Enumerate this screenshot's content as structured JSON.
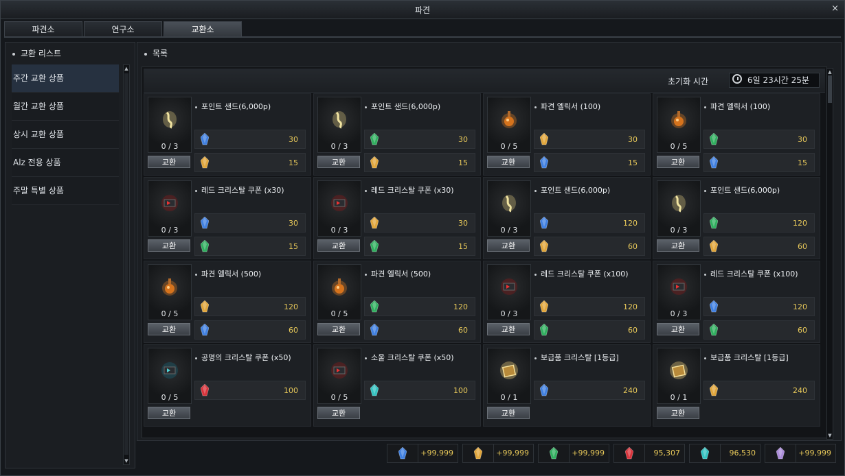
{
  "window": {
    "title": "파견",
    "close": "×"
  },
  "tabs": [
    {
      "label": "파견소"
    },
    {
      "label": "연구소"
    },
    {
      "label": "교환소",
      "active": true
    }
  ],
  "sidebar": {
    "heading": "교환 리스트",
    "items": [
      {
        "label": "주간 교환 상품",
        "active": true
      },
      {
        "label": "월간 교환 상품"
      },
      {
        "label": "상시 교환 상품"
      },
      {
        "label": "Alz 전용 상품"
      },
      {
        "label": "주말 특별 상품"
      }
    ]
  },
  "main": {
    "heading": "목록",
    "reset_label": "초기화 시간",
    "reset_value": "6일 23시간 25분",
    "exchange_label": "교환"
  },
  "items": [
    {
      "name": "포인트 샌드(6,000p)",
      "art": "sand",
      "count": "0 / 3",
      "costs": [
        {
          "gem": "blue",
          "value": "30"
        },
        {
          "gem": "gold",
          "value": "15"
        }
      ]
    },
    {
      "name": "포인트 샌드(6,000p)",
      "art": "sand",
      "count": "0 / 3",
      "costs": [
        {
          "gem": "green",
          "value": "30"
        },
        {
          "gem": "gold",
          "value": "15"
        }
      ]
    },
    {
      "name": "파견 엘릭서 (100)",
      "art": "elixir",
      "count": "0 / 5",
      "costs": [
        {
          "gem": "gold",
          "value": "30"
        },
        {
          "gem": "blue",
          "value": "15"
        }
      ]
    },
    {
      "name": "파견 엘릭서 (100)",
      "art": "elixir",
      "count": "0 / 5",
      "costs": [
        {
          "gem": "green",
          "value": "30"
        },
        {
          "gem": "blue",
          "value": "15"
        }
      ]
    },
    {
      "name": "레드 크리스탈 쿠폰 (x30)",
      "art": "coupon-red",
      "count": "0 / 3",
      "costs": [
        {
          "gem": "blue",
          "value": "30"
        },
        {
          "gem": "green",
          "value": "15"
        }
      ]
    },
    {
      "name": "레드 크리스탈 쿠폰 (x30)",
      "art": "coupon-red",
      "count": "0 / 3",
      "costs": [
        {
          "gem": "gold",
          "value": "30"
        },
        {
          "gem": "green",
          "value": "15"
        }
      ]
    },
    {
      "name": "포인트 샌드(6,000p)",
      "art": "sand",
      "count": "0 / 3",
      "costs": [
        {
          "gem": "blue",
          "value": "120"
        },
        {
          "gem": "gold",
          "value": "60"
        }
      ]
    },
    {
      "name": "포인트 샌드(6,000p)",
      "art": "sand",
      "count": "0 / 3",
      "costs": [
        {
          "gem": "green",
          "value": "120"
        },
        {
          "gem": "gold",
          "value": "60"
        }
      ]
    },
    {
      "name": "파견 엘릭서 (500)",
      "art": "elixir",
      "count": "0 / 5",
      "costs": [
        {
          "gem": "gold",
          "value": "120"
        },
        {
          "gem": "blue",
          "value": "60"
        }
      ]
    },
    {
      "name": "파견 엘릭서 (500)",
      "art": "elixir",
      "count": "0 / 5",
      "costs": [
        {
          "gem": "green",
          "value": "120"
        },
        {
          "gem": "blue",
          "value": "60"
        }
      ]
    },
    {
      "name": "레드 크리스탈 쿠폰 (x100)",
      "art": "coupon-red",
      "count": "0 / 3",
      "costs": [
        {
          "gem": "gold",
          "value": "120"
        },
        {
          "gem": "green",
          "value": "60"
        }
      ]
    },
    {
      "name": "레드 크리스탈 쿠폰 (x100)",
      "art": "coupon-red",
      "count": "0 / 3",
      "costs": [
        {
          "gem": "blue",
          "value": "120"
        },
        {
          "gem": "green",
          "value": "60"
        }
      ]
    },
    {
      "name": "공명의 크리스탈 쿠폰 (x50)",
      "art": "coupon-teal",
      "count": "0 / 5",
      "costs": [
        {
          "gem": "red",
          "value": "100"
        }
      ]
    },
    {
      "name": "소울 크리스탈 쿠폰 (x50)",
      "art": "coupon-red",
      "count": "0 / 5",
      "costs": [
        {
          "gem": "teal",
          "value": "100"
        }
      ]
    },
    {
      "name": "보급품 크리스탈 [1등급]",
      "art": "chest",
      "count": "0 / 1",
      "costs": [
        {
          "gem": "blue",
          "value": "240"
        }
      ]
    },
    {
      "name": "보급품 크리스탈 [1등급]",
      "art": "chest",
      "count": "0 / 1",
      "costs": [
        {
          "gem": "gold",
          "value": "240"
        }
      ]
    }
  ],
  "currencies": [
    {
      "gem": "blue",
      "value": "+99,999"
    },
    {
      "gem": "gold",
      "value": "+99,999"
    },
    {
      "gem": "green",
      "value": "+99,999"
    },
    {
      "gem": "red",
      "value": "95,307"
    },
    {
      "gem": "teal",
      "value": "96,530"
    },
    {
      "gem": "purple",
      "value": "+99,999"
    }
  ],
  "gem_colors": {
    "blue": "#3f7fe0",
    "gold": "#e0a53a",
    "green": "#2fae5e",
    "red": "#d8323a",
    "teal": "#33c2c0",
    "purple": "#a98ad8"
  }
}
